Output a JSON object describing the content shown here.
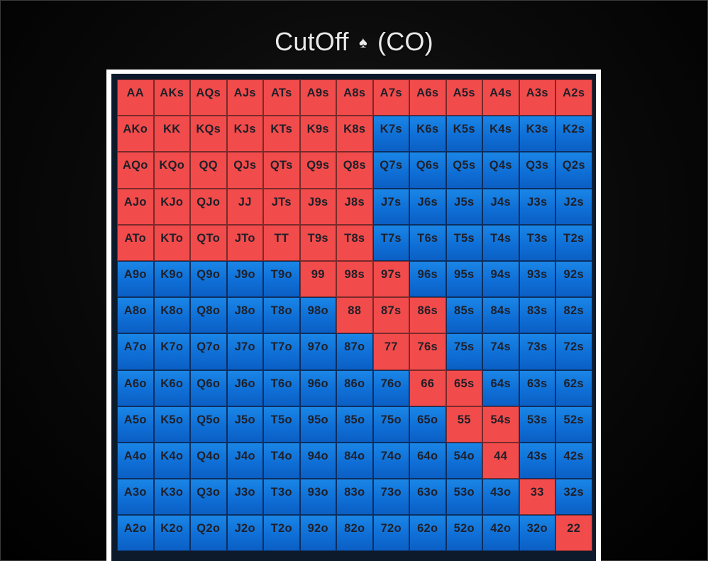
{
  "slide": {
    "title_main": "CutOff",
    "title_suit": "♠",
    "title_pos": "(CO)"
  },
  "colors": {
    "raise": "#f24b4b",
    "fold": "#1278dc",
    "frame": "#ffffff",
    "background": "#000000"
  },
  "hands": [
    [
      "AA",
      "AKs",
      "AQs",
      "AJs",
      "ATs",
      "A9s",
      "A8s",
      "A7s",
      "A6s",
      "A5s",
      "A4s",
      "A3s",
      "A2s"
    ],
    [
      "AKo",
      "KK",
      "KQs",
      "KJs",
      "KTs",
      "K9s",
      "K8s",
      "K7s",
      "K6s",
      "K5s",
      "K4s",
      "K3s",
      "K2s"
    ],
    [
      "AQo",
      "KQo",
      "QQ",
      "QJs",
      "QTs",
      "Q9s",
      "Q8s",
      "Q7s",
      "Q6s",
      "Q5s",
      "Q4s",
      "Q3s",
      "Q2s"
    ],
    [
      "AJo",
      "KJo",
      "QJo",
      "JJ",
      "JTs",
      "J9s",
      "J8s",
      "J7s",
      "J6s",
      "J5s",
      "J4s",
      "J3s",
      "J2s"
    ],
    [
      "ATo",
      "KTo",
      "QTo",
      "JTo",
      "TT",
      "T9s",
      "T8s",
      "T7s",
      "T6s",
      "T5s",
      "T4s",
      "T3s",
      "T2s"
    ],
    [
      "A9o",
      "K9o",
      "Q9o",
      "J9o",
      "T9o",
      "99",
      "98s",
      "97s",
      "96s",
      "95s",
      "94s",
      "93s",
      "92s"
    ],
    [
      "A8o",
      "K8o",
      "Q8o",
      "J8o",
      "T8o",
      "98o",
      "88",
      "87s",
      "86s",
      "85s",
      "84s",
      "83s",
      "82s"
    ],
    [
      "A7o",
      "K7o",
      "Q7o",
      "J7o",
      "T7o",
      "97o",
      "87o",
      "77",
      "76s",
      "75s",
      "74s",
      "73s",
      "72s"
    ],
    [
      "A6o",
      "K6o",
      "Q6o",
      "J6o",
      "T6o",
      "96o",
      "86o",
      "76o",
      "66",
      "65s",
      "64s",
      "63s",
      "62s"
    ],
    [
      "A5o",
      "K5o",
      "Q5o",
      "J5o",
      "T5o",
      "95o",
      "85o",
      "75o",
      "65o",
      "55",
      "54s",
      "53s",
      "52s"
    ],
    [
      "A4o",
      "K4o",
      "Q4o",
      "J4o",
      "T4o",
      "94o",
      "84o",
      "74o",
      "64o",
      "54o",
      "44",
      "43s",
      "42s"
    ],
    [
      "A3o",
      "K3o",
      "Q3o",
      "J3o",
      "T3o",
      "93o",
      "83o",
      "73o",
      "63o",
      "53o",
      "43o",
      "33",
      "32s"
    ],
    [
      "A2o",
      "K2o",
      "Q2o",
      "J2o",
      "T2o",
      "92o",
      "82o",
      "72o",
      "62o",
      "52o",
      "42o",
      "32o",
      "22"
    ]
  ],
  "range": [
    [
      1,
      1,
      1,
      1,
      1,
      1,
      1,
      1,
      1,
      1,
      1,
      1,
      1
    ],
    [
      1,
      1,
      1,
      1,
      1,
      1,
      1,
      0,
      0,
      0,
      0,
      0,
      0
    ],
    [
      1,
      1,
      1,
      1,
      1,
      1,
      1,
      0,
      0,
      0,
      0,
      0,
      0
    ],
    [
      1,
      1,
      1,
      1,
      1,
      1,
      1,
      0,
      0,
      0,
      0,
      0,
      0
    ],
    [
      1,
      1,
      1,
      1,
      1,
      1,
      1,
      0,
      0,
      0,
      0,
      0,
      0
    ],
    [
      0,
      0,
      0,
      0,
      0,
      1,
      1,
      1,
      0,
      0,
      0,
      0,
      0
    ],
    [
      0,
      0,
      0,
      0,
      0,
      0,
      1,
      1,
      1,
      0,
      0,
      0,
      0
    ],
    [
      0,
      0,
      0,
      0,
      0,
      0,
      0,
      1,
      1,
      0,
      0,
      0,
      0
    ],
    [
      0,
      0,
      0,
      0,
      0,
      0,
      0,
      0,
      1,
      1,
      0,
      0,
      0
    ],
    [
      0,
      0,
      0,
      0,
      0,
      0,
      0,
      0,
      0,
      1,
      1,
      0,
      0
    ],
    [
      0,
      0,
      0,
      0,
      0,
      0,
      0,
      0,
      0,
      0,
      1,
      0,
      0
    ],
    [
      0,
      0,
      0,
      0,
      0,
      0,
      0,
      0,
      0,
      0,
      0,
      1,
      0
    ],
    [
      0,
      0,
      0,
      0,
      0,
      0,
      0,
      0,
      0,
      0,
      0,
      0,
      1
    ]
  ]
}
